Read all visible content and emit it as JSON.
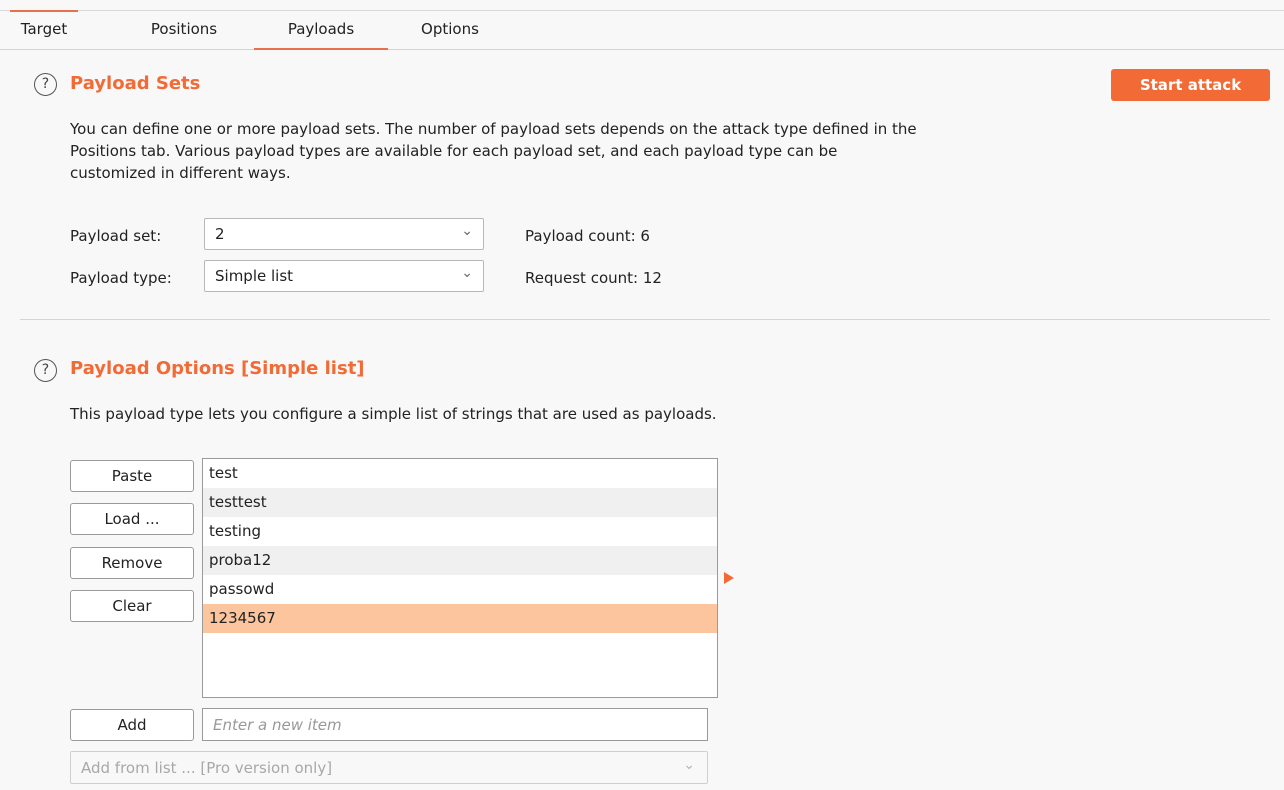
{
  "tabs": [
    {
      "label": "Target"
    },
    {
      "label": "Positions"
    },
    {
      "label": "Payloads"
    },
    {
      "label": "Options"
    }
  ],
  "active_tab": "Payloads",
  "payload_sets": {
    "title": "Payload Sets",
    "start_attack": "Start attack",
    "description_line1": "You can define one or more payload sets. The number of payload sets depends on the attack type defined in the",
    "description_line2": "Positions tab. Various payload types are available for each payload set, and each payload type can be",
    "description_line3": "customized in different ways.",
    "set_label": "Payload set:",
    "set_value": "2",
    "type_label": "Payload type:",
    "type_value": "Simple list",
    "payload_count": "Payload count:  6",
    "request_count": "Request count:  12"
  },
  "payload_options": {
    "title": "Payload Options [Simple list]",
    "description": "This payload type lets you configure a simple list of strings that are used as payloads.",
    "buttons": {
      "paste": "Paste",
      "load": "Load ...",
      "remove": "Remove",
      "clear": "Clear",
      "add": "Add"
    },
    "items": [
      "test",
      "testtest",
      "testing",
      "proba12",
      "passowd",
      "1234567"
    ],
    "selected_index": 5,
    "new_item_placeholder": "Enter a new item",
    "add_from_list": "Add from list ... [Pro version only]"
  },
  "icons": {
    "help": "question-circle-icon",
    "chevron": "chevron-down-icon",
    "arrow": "triangle-right-icon"
  },
  "colors": {
    "accent": "#f26a35",
    "selection": "#fcc59d"
  }
}
